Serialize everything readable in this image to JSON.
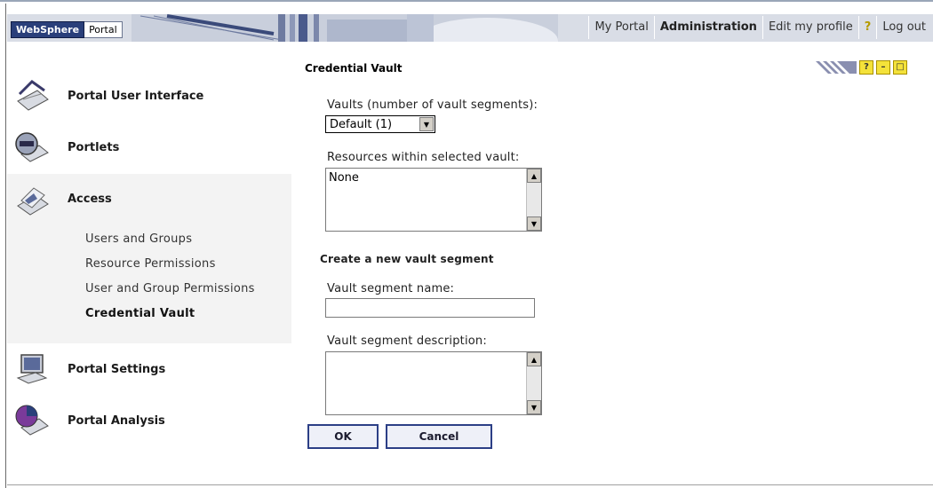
{
  "header": {
    "logo_primary": "WebSphere",
    "logo_secondary": "Portal",
    "links": [
      "My Portal",
      "Administration",
      "Edit my profile",
      "?",
      "Log out"
    ],
    "active_link": "Administration",
    "colors": {
      "banner": "#d9dde6",
      "logo_bg": "#2a3f7a",
      "help": "#b59a00"
    }
  },
  "sidebar": {
    "sections": [
      {
        "label": "Portal User Interface",
        "icon": "portal-ui-icon"
      },
      {
        "label": "Portlets",
        "icon": "portlets-icon"
      },
      {
        "label": "Access",
        "icon": "access-icon"
      },
      {
        "label": "Portal Settings",
        "icon": "portal-settings-icon"
      },
      {
        "label": "Portal Analysis",
        "icon": "portal-analysis-icon"
      }
    ],
    "access_items": [
      "Users and Groups",
      "Resource Permissions",
      "User and Group Permissions",
      "Credential Vault"
    ],
    "selected_item": "Credential Vault"
  },
  "portlet": {
    "title": "Credential Vault",
    "controls": [
      "?",
      "–",
      "□"
    ],
    "vaults_label": "Vaults (number of vault segments):",
    "vault_selected": "Default (1)",
    "resources_label": "Resources within selected vault:",
    "resources": [
      "None"
    ],
    "create_heading": "Create a new vault segment",
    "segment_name_label": "Vault segment name:",
    "segment_name_value": "",
    "segment_desc_label": "Vault segment description:",
    "segment_desc_value": "",
    "ok_label": "OK",
    "cancel_label": "Cancel"
  }
}
